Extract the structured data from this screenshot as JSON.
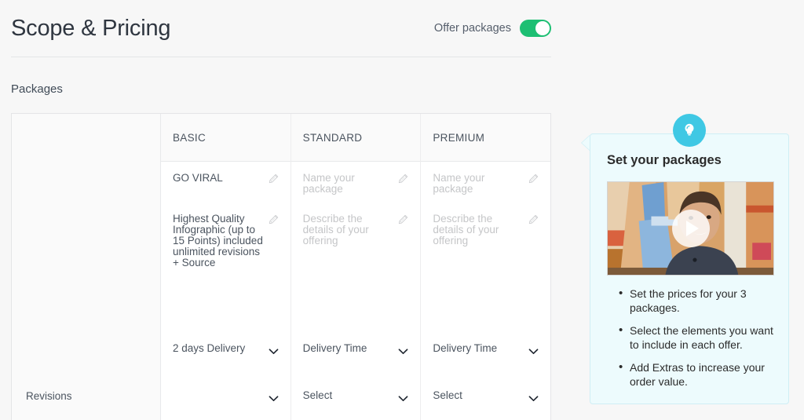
{
  "header": {
    "title": "Scope & Pricing",
    "toggle_label": "Offer packages",
    "toggle_on": true,
    "toggle_on_color": "#1dbf73"
  },
  "section": {
    "title": "Packages"
  },
  "table": {
    "row_labels": {
      "revisions": "Revisions"
    },
    "columns": [
      {
        "header": "BASIC",
        "name": "GO VIRAL",
        "name_is_placeholder": false,
        "description": "Highest Quality Infographic (up to 15 Points) included unlimited revisions + Source",
        "description_is_placeholder": false,
        "delivery": "2 days Delivery",
        "delivery_is_placeholder": false,
        "revisions": "",
        "revisions_is_placeholder": true
      },
      {
        "header": "STANDARD",
        "name": "Name your package",
        "name_is_placeholder": true,
        "description": "Describe the details of your offering",
        "description_is_placeholder": true,
        "delivery": "Delivery Time",
        "delivery_is_placeholder": false,
        "revisions": "Select",
        "revisions_is_placeholder": false
      },
      {
        "header": "PREMIUM",
        "name": "Name your package",
        "name_is_placeholder": true,
        "description": "Describe the details of your offering",
        "description_is_placeholder": true,
        "delivery": "Delivery Time",
        "delivery_is_placeholder": false,
        "revisions": "Select",
        "revisions_is_placeholder": false
      }
    ]
  },
  "tip": {
    "title": "Set your packages",
    "icon": "lightbulb-icon",
    "accent_color": "#3fc8e4",
    "background_color": "#edfbfd",
    "bullets": [
      "Set the prices for your 3 packages.",
      "Select the elements you want to include in each offer.",
      "Add Extras to increase your order value."
    ]
  }
}
